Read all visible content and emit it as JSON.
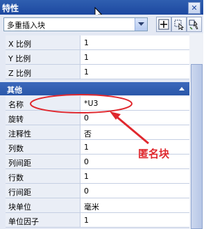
{
  "window": {
    "title": "特性",
    "close_glyph": "✕"
  },
  "toolbar": {
    "object_type": "多重插入块",
    "buttons": [
      "toggle-pickadd-icon",
      "select-objects-icon",
      "quick-select-icon"
    ]
  },
  "scale_rows": [
    {
      "label": "X 比例",
      "value": "1"
    },
    {
      "label": "Y 比例",
      "value": "1"
    },
    {
      "label": "Z 比例",
      "value": "1"
    }
  ],
  "misc_group": {
    "title": "其他",
    "rows": [
      {
        "label": "名称",
        "value": "*U3"
      },
      {
        "label": "旋转",
        "value": "0"
      },
      {
        "label": "注释性",
        "value": "否"
      },
      {
        "label": "列数",
        "value": "1"
      },
      {
        "label": "列间距",
        "value": "0"
      },
      {
        "label": "行数",
        "value": "1"
      },
      {
        "label": "行间距",
        "value": "0"
      },
      {
        "label": "块单位",
        "value": "毫米"
      },
      {
        "label": "单位因子",
        "value": "1"
      }
    ]
  },
  "annotation": {
    "text": "匿名块",
    "color": "#e0282e"
  },
  "colors": {
    "titlebar": "#2f5fb0",
    "group_header": "#2a57a9",
    "annotation": "#e0282e"
  }
}
